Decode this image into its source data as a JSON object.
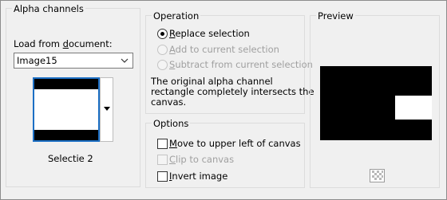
{
  "alpha_channels": {
    "title": "Alpha channels",
    "load_label_pre": "Load from ",
    "load_label_u": "d",
    "load_label_post": "ocument:",
    "document_value": "Image15",
    "channel_name": "Selectie 2"
  },
  "operation": {
    "title": "Operation",
    "replace": {
      "u": "R",
      "rest": "eplace selection",
      "checked": true,
      "enabled": true
    },
    "add": {
      "u": "A",
      "rest": "dd to current selection",
      "checked": false,
      "enabled": false
    },
    "subtract": {
      "u": "S",
      "rest": "ubtract from current selection",
      "checked": false,
      "enabled": false
    },
    "message_line1": "The original alpha channel",
    "message_line2": "rectangle completely intersects the",
    "message_line3": "canvas."
  },
  "options": {
    "title": "Options",
    "move": {
      "u": "M",
      "rest": "ove to upper left of canvas",
      "checked": false,
      "enabled": true
    },
    "clip": {
      "u": "C",
      "rest": "lip to canvas",
      "checked": false,
      "enabled": false
    },
    "invert": {
      "u": "I",
      "rest": "nvert image",
      "checked": false,
      "enabled": true
    }
  },
  "preview": {
    "title": "Preview"
  }
}
